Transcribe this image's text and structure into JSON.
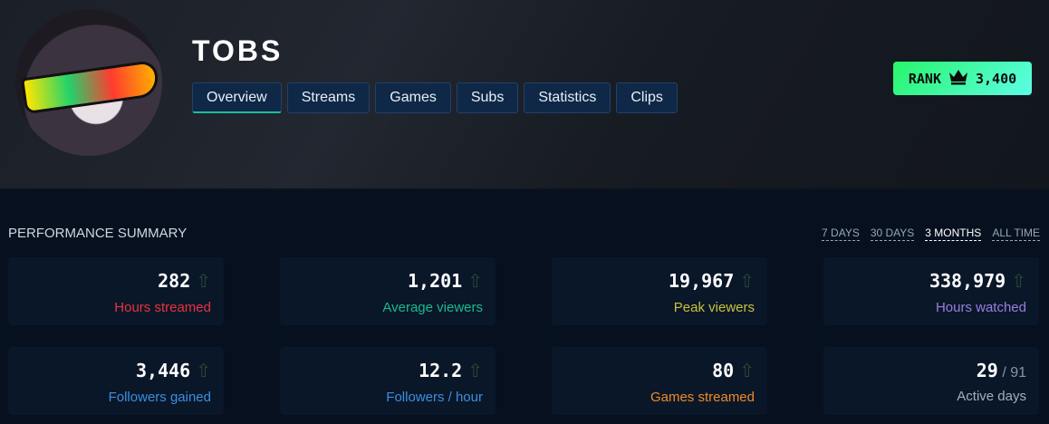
{
  "channel": {
    "name": "TOBS"
  },
  "tabs": [
    "Overview",
    "Streams",
    "Games",
    "Subs",
    "Statistics",
    "Clips"
  ],
  "rank": {
    "label": "RANK",
    "value": "3,400"
  },
  "summary": {
    "title": "PERFORMANCE SUMMARY",
    "ranges": [
      "7 DAYS",
      "30 DAYS",
      "3 MONTHS",
      "ALL TIME"
    ],
    "active_range": "3 MONTHS",
    "stats": [
      {
        "value": "282",
        "label": "Hours streamed",
        "color": "#e8333f",
        "arrow": "⇧"
      },
      {
        "value": "1,201",
        "label": "Average viewers",
        "color": "#1bb98f",
        "arrow": "⇧"
      },
      {
        "value": "19,967",
        "label": "Peak viewers",
        "color": "#c9c23a",
        "arrow": "⇧"
      },
      {
        "value": "338,979",
        "label": "Hours watched",
        "color": "#9a7ee0",
        "arrow": "⇧"
      },
      {
        "value": "3,446",
        "label": "Followers gained",
        "color": "#3a8fe0",
        "arrow": "⇧"
      },
      {
        "value": "12.2",
        "label": "Followers / hour",
        "color": "#3a8fe0",
        "arrow": "⇧"
      },
      {
        "value": "80",
        "label": "Games streamed",
        "color": "#f08a24",
        "arrow": "⇧"
      },
      {
        "value": "29",
        "total": "/ 91",
        "label": "Active days",
        "color": "#a6aeb9"
      }
    ]
  }
}
